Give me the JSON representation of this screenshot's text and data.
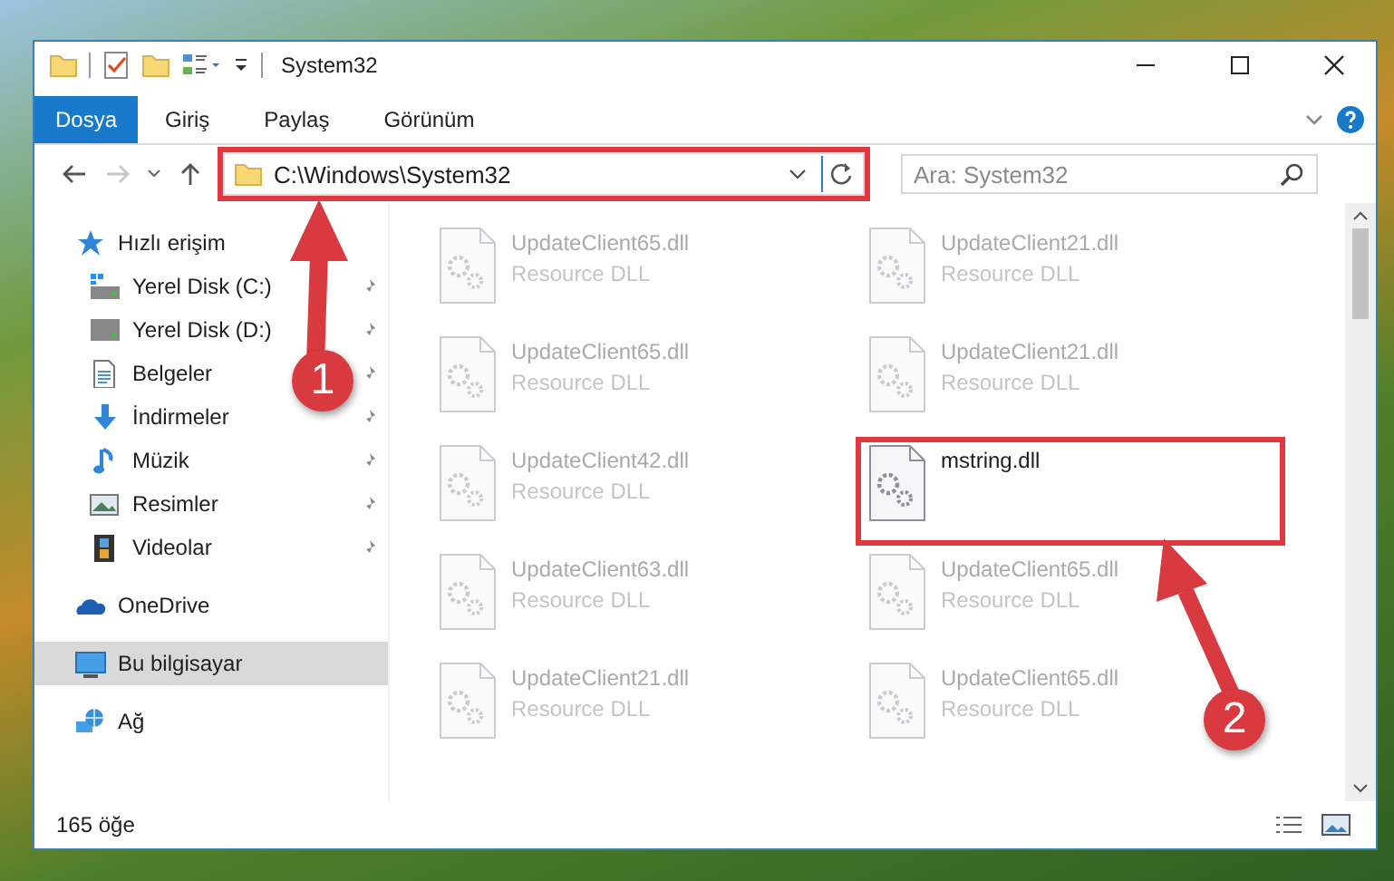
{
  "window": {
    "title": "System32"
  },
  "ribbon": {
    "tabs": [
      {
        "label": "Dosya",
        "selected": true,
        "kind": "file"
      },
      {
        "label": "Giriş",
        "selected": false,
        "kind": "tab"
      },
      {
        "label": "Paylaş",
        "selected": false,
        "kind": "tab"
      },
      {
        "label": "Görünüm",
        "selected": false,
        "kind": "tab"
      }
    ]
  },
  "address": {
    "path": "C:\\Windows\\System32",
    "highlighted": true
  },
  "search": {
    "placeholder": "Ara: System32"
  },
  "sidebar": {
    "items": [
      {
        "label": "Hızlı erişim",
        "selected": false,
        "children": [
          {
            "label": "Yerel Disk (C:)",
            "pinned": true,
            "selected": false
          },
          {
            "label": "Yerel Disk (D:)",
            "pinned": true,
            "selected": false
          },
          {
            "label": "Belgeler",
            "pinned": true,
            "selected": false
          },
          {
            "label": "İndirmeler",
            "pinned": true,
            "selected": false
          },
          {
            "label": "Müzik",
            "pinned": true,
            "selected": false
          },
          {
            "label": "Resimler",
            "pinned": true,
            "selected": false
          },
          {
            "label": "Videolar",
            "pinned": true,
            "selected": false
          }
        ]
      },
      {
        "label": "OneDrive",
        "selected": false
      },
      {
        "label": "Bu bilgisayar",
        "selected": true
      },
      {
        "label": "Ağ",
        "selected": false
      }
    ]
  },
  "files": [
    {
      "name": "UpdateClient65.dll",
      "type": "Resource DLL",
      "faded": true,
      "highlighted": false
    },
    {
      "name": "UpdateClient21.dll",
      "type": "Resource DLL",
      "faded": true,
      "highlighted": false
    },
    {
      "name": "UpdateClient65.dll",
      "type": "Resource DLL",
      "faded": true,
      "highlighted": false
    },
    {
      "name": "UpdateClient21.dll",
      "type": "Resource DLL",
      "faded": true,
      "highlighted": false
    },
    {
      "name": "UpdateClient42.dll",
      "type": "Resource DLL",
      "faded": true,
      "highlighted": false
    },
    {
      "name": "mstring.dll",
      "faded": false,
      "highlighted": true
    },
    {
      "name": "UpdateClient63.dll",
      "type": "Resource DLL",
      "faded": true,
      "highlighted": false
    },
    {
      "name": "UpdateClient65.dll",
      "type": "Resource DLL",
      "faded": true,
      "highlighted": false
    },
    {
      "name": "UpdateClient21.dll",
      "type": "Resource DLL",
      "faded": true,
      "highlighted": false
    },
    {
      "name": "UpdateClient65.dll",
      "type": "Resource DLL",
      "faded": true,
      "highlighted": false
    }
  ],
  "status_bar": {
    "count": "165 öğe"
  },
  "steps": [
    {
      "number": "1"
    },
    {
      "number": "2"
    }
  ]
}
